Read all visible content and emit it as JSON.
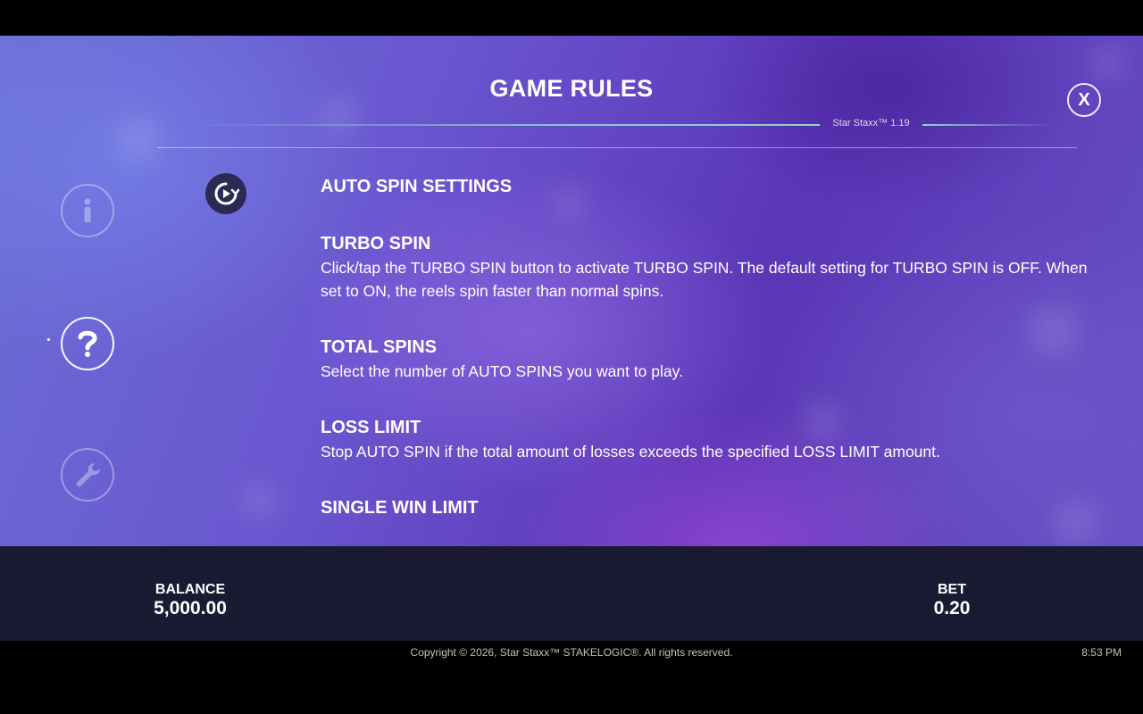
{
  "header": {
    "title": "GAME RULES",
    "version": "Star Staxx™ 1.19",
    "close_label": "X"
  },
  "nav": {
    "items": [
      {
        "name": "info",
        "icon": "info-icon",
        "active": false
      },
      {
        "name": "help",
        "icon": "question-icon",
        "active": true
      },
      {
        "name": "settings",
        "icon": "wrench-icon",
        "active": false
      }
    ]
  },
  "content": {
    "section_icon": "autoplay-icon",
    "section_title": "AUTO SPIN SETTINGS",
    "subsections": [
      {
        "title": "TURBO SPIN",
        "text": "Click/tap the TURBO SPIN button to activate TURBO SPIN. The default setting for TURBO SPIN is OFF. When set to ON, the reels spin faster than normal spins."
      },
      {
        "title": "TOTAL SPINS",
        "text": "Select the number of AUTO SPINS you want to play."
      },
      {
        "title": "LOSS LIMIT",
        "text": "Stop AUTO SPIN if the total amount of losses exceeds the specified LOSS LIMIT amount."
      },
      {
        "title": "SINGLE WIN LIMIT",
        "text": ""
      }
    ]
  },
  "status_bar": {
    "balance_label": "BALANCE",
    "balance_value": "5,000.00",
    "bet_label": "BET",
    "bet_value": "0.20"
  },
  "footer": {
    "copyright": "Copyright © 2026, Star Staxx™ STAKELOGIC®. All rights reserved.",
    "time": "8:53 PM"
  },
  "colors": {
    "panel_purple": "#5b36b6",
    "bar_dark": "#1a1a33",
    "accent_line": "#96e6d2"
  }
}
